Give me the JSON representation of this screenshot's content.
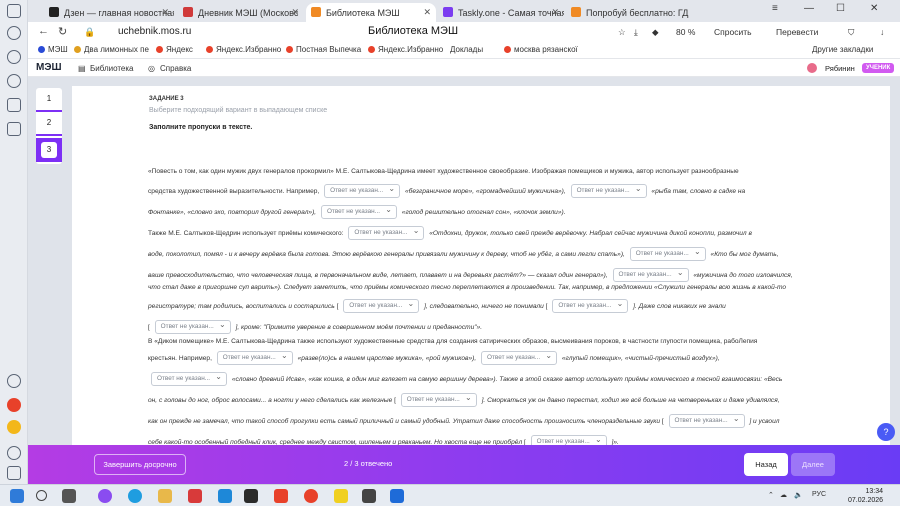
{
  "browser": {
    "tabs": [
      {
        "label": "Дзен — главная новостная",
        "color": "#222"
      },
      {
        "label": "Дневник МЭШ (Московс",
        "color": "#d03a3a"
      },
      {
        "label": "Библиотека МЭШ",
        "color": "#f08a24"
      },
      {
        "label": "Taskly.one - Самая точная",
        "color": "#7b3cf0"
      },
      {
        "label": "Попробуй бесплатно: ГД",
        "color": "#f08a24"
      }
    ],
    "url": "uchebnik.mos.ru",
    "page_title": "Библиотека МЭШ",
    "zoom": "80 %",
    "ask": "Спросить",
    "translate": "Перевести",
    "bookmarks": [
      "МЭШ",
      "Два лимонных пе",
      "Яндекс",
      "Яндекс.Избранно",
      "Постная Выпечка",
      "Яндекс.Избранно",
      "Доклады",
      "москва рязанскої"
    ],
    "other_bookmarks": "Другие закладки"
  },
  "site": {
    "logo": "МЭШ",
    "library": "Библиотека",
    "help": "Справка",
    "user": "Рябинин",
    "role": "УЧЕНИК"
  },
  "question_nav": [
    "1",
    "2",
    "3"
  ],
  "task": {
    "header": "ЗАДАНИЕ 3",
    "subtitle": "Выберите подходящий вариант в выпадающем списке",
    "instruction": "Заполните пропуски в тексте.",
    "placeholder": "Ответ не указан...",
    "lines": {
      "l1": "«Повесть о том, как один мужик двух генералов прокормил» М.Е. Салтыкова-Щедрина имеет художественное своеобразие. Изображая помещиков и мужика, автор использует разнообразные",
      "l2a": "средства художественной выразительности. Например,",
      "l2b": "«безграничное море», «громаднейший мужичина»),",
      "l2c": "«рыба там, словно в садке на",
      "l3a": "Фонтанке», «словно эхо, повторил другой генерал»),",
      "l3b": "«голод решительно отогнал сон», «клочок земли»).",
      "l4a": "Также М.Е. Салтыков-Щедрин использует приёмы комического:",
      "l4b": "«Отдохни, дружок, только свей прежде верёвочку. Набрал сейчас мужичина дикой конопли, размочил в",
      "l5a": "воде, поколотил, помял - и к вечеру верёвка была готова. Этою верёвкою генералы привязали мужичину к дереву, чтоб не убёг, а сами легли спать»),",
      "l5b": "«Кто бы мог думать,",
      "l6a": "ваше превосходительство, что человеческая пища, в первоначальном виде, летает, плавает и на деревьях растёт?» — сказал один генерал»),",
      "l6b": "«мужичина до того изловчился,",
      "l7": "что стал даже в пригоршне суп варить»). Следует заметить, что приёмы комического тесно переплетаются в произведении. Так, например, в предложении «Служили генералы всю жизнь в какой-то",
      "l8a": "регистратуре; там родились, воспитались и состарились",
      "l8b": "], следовательно, ничего не понимали",
      "l8c": "]. Даже слов никаких не знали",
      "l9": "], кроме: \"Примите уверение в совершенном моём почтении и преданности\"».",
      "l10": "В «Диком помещике» М.Е. Салтыкова-Щедрина также используют художественные средства для создания сатирических образов, высмеивания пороков, в частности глупости помещика, рабоЛепия",
      "l11a": "крестьян. Например,",
      "l11b": "«разве(ло)сь в нашем царстве мужика», «рой мужиков»),",
      "l11c": "«глупый помещик», «чистый-пречистый воздух»),",
      "l12": "«словно древний Исав», «как кошка, в один миг взлезет на самую вершину дерева»). Также в этой сказке автор использует приёмы комического в тесной взаимосвязи: «Весь",
      "l13a": "он, с головы до ног, оброс волосами... а ногти у него сделались как железные",
      "l13b": "]. Сморкаться уж он давно перестал, ходил же всё больше на четвереньках и даже удивлялся,",
      "l14a": "как он прежде не замечал, что такой способ прогулки есть самый приличный и самый удобный. Утратил даже способность произносить членораздельные звуки",
      "l14b": "] и усвоил",
      "l15a": "себе какой-то особенный победный клик, среднее между свистом, шипеньем и рявканьем. Но хвоста еще не приобрёл",
      "l15b": "]»."
    }
  },
  "footer": {
    "finish_early": "Завершить досрочно",
    "status": "2 / 3 отвечено",
    "back": "Назад",
    "next": "Далее"
  },
  "taskbar": {
    "lang": "РУС",
    "time": "13:34",
    "date": "07.02.2026"
  }
}
